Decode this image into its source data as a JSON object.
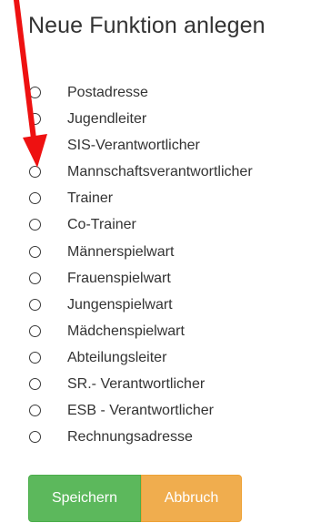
{
  "form": {
    "title": "Neue Funktion anlegen",
    "options": [
      {
        "label": "Postadresse",
        "checked": false
      },
      {
        "label": "Jugendleiter",
        "checked": false
      },
      {
        "label": "SIS-Verantwortlicher",
        "checked": false
      },
      {
        "label": "Mannschaftsverantwortlicher",
        "checked": false
      },
      {
        "label": "Trainer",
        "checked": false
      },
      {
        "label": "Co-Trainer",
        "checked": false
      },
      {
        "label": "Männerspielwart",
        "checked": false
      },
      {
        "label": "Frauenspielwart",
        "checked": false
      },
      {
        "label": "Jungenspielwart",
        "checked": false
      },
      {
        "label": "Mädchenspielwart",
        "checked": false
      },
      {
        "label": "Abteilungsleiter",
        "checked": false
      },
      {
        "label": "SR.- Verantwortlicher",
        "checked": false
      },
      {
        "label": "ESB - Verantwortlicher",
        "checked": false
      },
      {
        "label": "Rechnungsadresse",
        "checked": false
      }
    ],
    "save_label": "Speichern",
    "cancel_label": "Abbruch"
  },
  "colors": {
    "save_button": "#5cb85c",
    "cancel_button": "#f0ad4e",
    "annotation_arrow": "#ee1111"
  }
}
